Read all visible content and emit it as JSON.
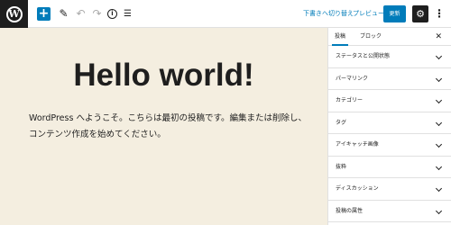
{
  "toolbar": {
    "logo_letter": "W",
    "add_symbol": "+",
    "tools_symbol": "✎",
    "undo_symbol": "↶",
    "redo_symbol": "↷",
    "info_symbol": "i",
    "outline_symbol": "☰",
    "switch_to_draft": "下書きへ切り替え",
    "preview": "プレビュー",
    "publish": "更新",
    "settings_symbol": "⚙",
    "more_symbol": "⋮"
  },
  "editor": {
    "title": "Hello world!",
    "paragraph": "WordPress へようこそ。こちらは最初の投稿です。編集または削除し、コンテンツ作成を始めてください。",
    "background": "#f4eee0"
  },
  "sidebar": {
    "tabs": [
      {
        "label": "投稿",
        "active": true
      },
      {
        "label": "ブロック",
        "active": false
      }
    ],
    "close_symbol": "✕",
    "panels": [
      {
        "label": "ステータスと公開状態"
      },
      {
        "label": "パーマリンク"
      },
      {
        "label": "カテゴリー"
      },
      {
        "label": "タグ"
      },
      {
        "label": "アイキャッチ画像"
      },
      {
        "label": "抜粋"
      },
      {
        "label": "ディスカッション"
      },
      {
        "label": "投稿の属性"
      }
    ]
  },
  "colors": {
    "accent": "#007cba",
    "dark": "#1e1e1e"
  },
  "icons": [
    "wordpress-logo-icon",
    "plus-icon",
    "pencil-icon",
    "undo-icon",
    "redo-icon",
    "info-icon",
    "list-view-icon",
    "gear-icon",
    "more-vertical-icon",
    "close-icon",
    "chevron-down-icon"
  ]
}
